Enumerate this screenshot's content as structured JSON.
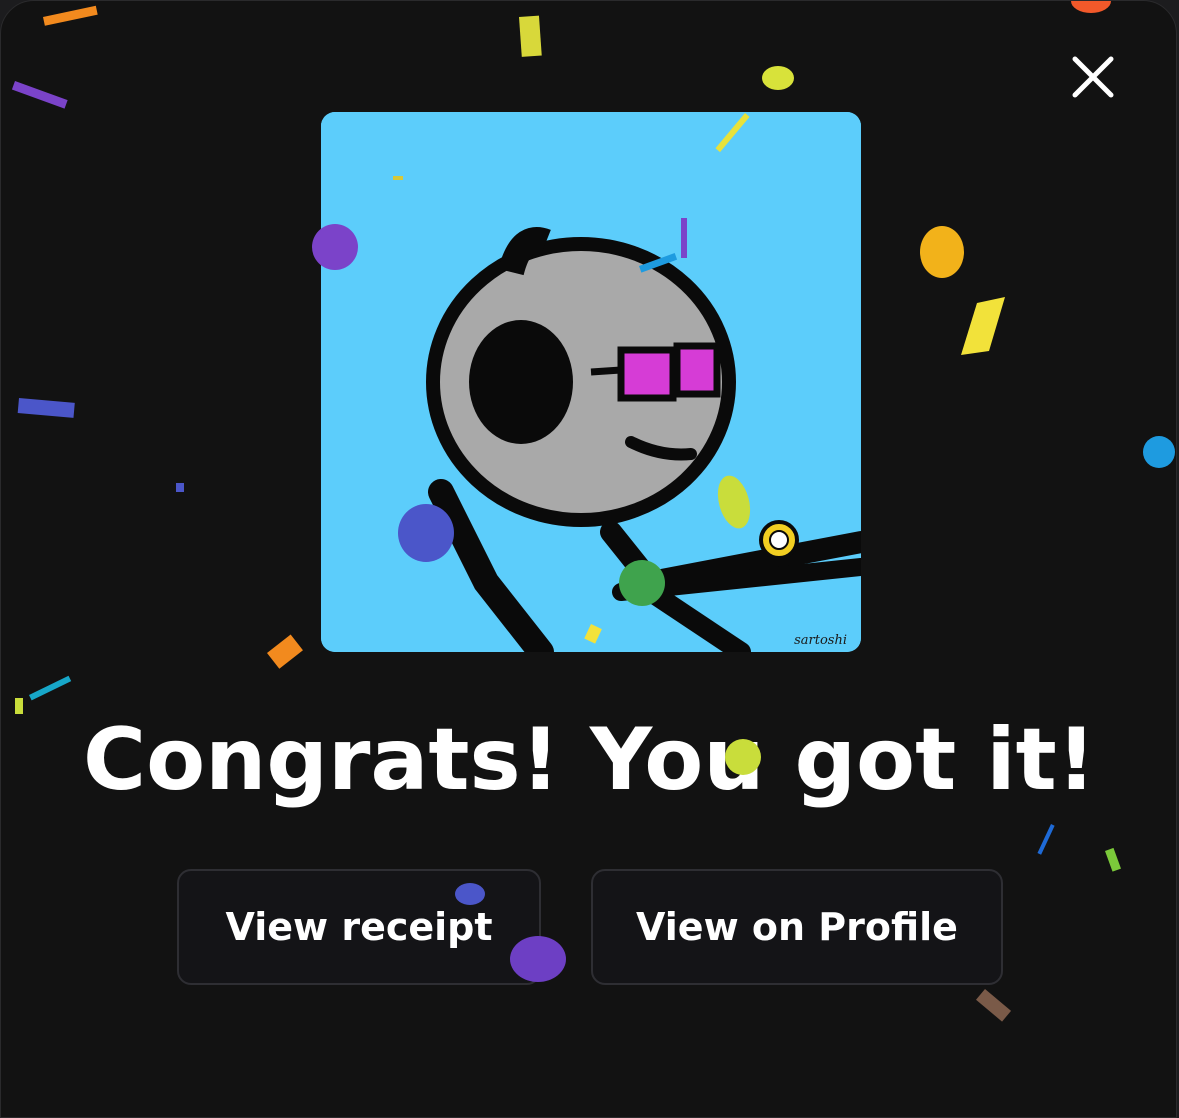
{
  "dialog": {
    "headline": "Congrats! You got it!",
    "close_icon": "close-icon"
  },
  "artwork": {
    "signature": "sartoshi"
  },
  "actions": {
    "view_receipt_label": "View receipt",
    "view_profile_label": "View on Profile"
  },
  "colors": {
    "background": "#121212",
    "artwork_background": "#5ccdfb",
    "button_background": "#141417",
    "button_border": "#2e2e33",
    "text": "#ffffff"
  }
}
